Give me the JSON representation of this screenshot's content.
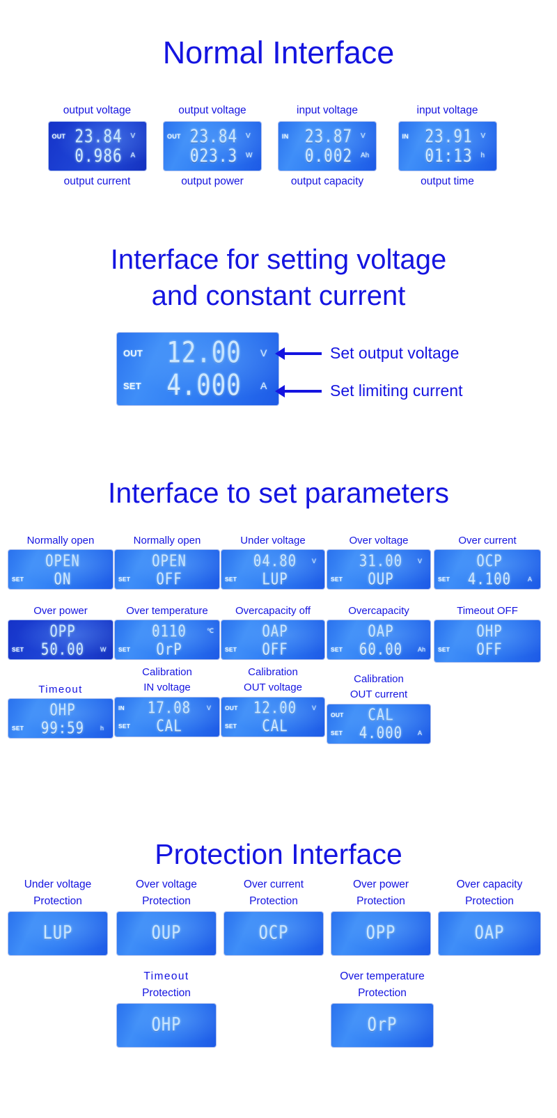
{
  "sections": {
    "normal_title": "Normal Interface",
    "setting_title_line1": "Interface for setting voltage",
    "setting_title_line2": "and constant current",
    "params_title": "Interface to set parameters",
    "protection_title": "Protection Interface"
  },
  "colors": {
    "text_blue": "#1414e0",
    "lcd_blue": "#2f7df4",
    "lcd_blue_dark": "#1633c8",
    "segment": "#d6ecff"
  },
  "normal": [
    {
      "caption_top": "output voltage",
      "caption_bottom": "output current",
      "lcd_style": "dark",
      "line1": {
        "tag": "OUT",
        "value": "23.84",
        "unit": "V"
      },
      "line2": {
        "tag": "",
        "value": "0.986",
        "unit": "A"
      }
    },
    {
      "caption_top": "output voltage",
      "caption_bottom": "output power",
      "lcd_style": "bright",
      "line1": {
        "tag": "OUT",
        "value": "23.84",
        "unit": "V"
      },
      "line2": {
        "tag": "",
        "value": "023.3",
        "unit": "W"
      }
    },
    {
      "caption_top": "input voltage",
      "caption_bottom": "output capacity",
      "lcd_style": "bright",
      "line1": {
        "tag": "IN",
        "value": "23.87",
        "unit": "V"
      },
      "line2": {
        "tag": "",
        "value": "0.002",
        "unit": "Ah"
      }
    },
    {
      "caption_top": "input voltage",
      "caption_bottom": "output time",
      "lcd_style": "bright",
      "line1": {
        "tag": "IN",
        "value": "23.91",
        "unit": "V"
      },
      "line2": {
        "tag": "",
        "value": "01:13",
        "unit": "h"
      }
    }
  ],
  "setting": {
    "lcd": {
      "line1": {
        "tag": "OUT",
        "value": "12.00",
        "unit": "V"
      },
      "line2": {
        "tag": "SET",
        "value": "4.000",
        "unit": "A"
      }
    },
    "annotation_voltage": "Set output voltage",
    "annotation_current": "Set limiting current"
  },
  "params": [
    [
      {
        "caption": "Normally open",
        "lcd_style": "bright",
        "line1": {
          "tag": "",
          "value": "OPEN",
          "unit": ""
        },
        "line2": {
          "tag": "SET",
          "value": "ON",
          "unit": ""
        }
      },
      {
        "caption": "Normally open",
        "lcd_style": "bright",
        "line1": {
          "tag": "",
          "value": "OPEN",
          "unit": ""
        },
        "line2": {
          "tag": "SET",
          "value": "OFF",
          "unit": ""
        }
      },
      {
        "caption": "Under voltage",
        "lcd_style": "bright",
        "line1": {
          "tag": "",
          "value": "04.80",
          "unit": "V"
        },
        "line2": {
          "tag": "SET",
          "value": "LUP",
          "unit": ""
        }
      },
      {
        "caption": "Over voltage",
        "lcd_style": "bright",
        "line1": {
          "tag": "",
          "value": "31.00",
          "unit": "V"
        },
        "line2": {
          "tag": "SET",
          "value": "OUP",
          "unit": ""
        }
      },
      {
        "caption": "Over current",
        "lcd_style": "bright",
        "line1": {
          "tag": "",
          "value": "OCP",
          "unit": ""
        },
        "line2": {
          "tag": "SET",
          "value": "4.100",
          "unit": "A"
        }
      }
    ],
    [
      {
        "caption": "Over power",
        "lcd_style": "dark",
        "line1": {
          "tag": "",
          "value": "OPP",
          "unit": ""
        },
        "line2": {
          "tag": "SET",
          "value": "50.00",
          "unit": "W"
        }
      },
      {
        "caption": "Over temperature",
        "lcd_style": "bright",
        "line1": {
          "tag": "",
          "value": "0110",
          "unit": "℃"
        },
        "line2": {
          "tag": "SET",
          "value": "OrP",
          "unit": ""
        }
      },
      {
        "caption": "Overcapacity off",
        "lcd_style": "bright",
        "line1": {
          "tag": "",
          "value": "OAP",
          "unit": ""
        },
        "line2": {
          "tag": "SET",
          "value": "OFF",
          "unit": ""
        }
      },
      {
        "caption": "Overcapacity",
        "lcd_style": "bright",
        "line1": {
          "tag": "",
          "value": "OAP",
          "unit": ""
        },
        "line2": {
          "tag": "SET",
          "value": "60.00",
          "unit": "Ah"
        }
      },
      {
        "caption": "Timeout OFF",
        "lcd_style": "bright",
        "line1": {
          "tag": "",
          "value": "OHP",
          "unit": ""
        },
        "line2": {
          "tag": "SET",
          "value": "OFF",
          "unit": ""
        }
      }
    ],
    [
      {
        "caption": "Timeout",
        "caption2": "",
        "lcd_style": "bright",
        "line1": {
          "tag": "",
          "value": "OHP",
          "unit": ""
        },
        "line2": {
          "tag": "SET",
          "value": "99:59",
          "unit": "h"
        }
      },
      {
        "caption": "Calibration",
        "caption2": "IN voltage",
        "lcd_style": "bright",
        "line1": {
          "tag": "IN",
          "value": "17.08",
          "unit": "V"
        },
        "line2": {
          "tag": "SET",
          "value": "CAL",
          "unit": ""
        }
      },
      {
        "caption": "Calibration",
        "caption2": "OUT voltage",
        "lcd_style": "bright",
        "line1": {
          "tag": "OUT",
          "value": "12.00",
          "unit": "V"
        },
        "line2": {
          "tag": "SET",
          "value": "CAL",
          "unit": ""
        }
      },
      {
        "caption": "Calibration",
        "caption2": "OUT current",
        "lcd_style": "bright",
        "line1": {
          "tag": "OUT",
          "value": "CAL",
          "unit": ""
        },
        "line2": {
          "tag": "SET",
          "value": "4.000",
          "unit": "A"
        }
      }
    ]
  ],
  "protection": [
    [
      {
        "caption1": "Under voltage",
        "caption2": "Protection",
        "value": "LUP"
      },
      {
        "caption1": "Over voltage",
        "caption2": "Protection",
        "value": "OUP"
      },
      {
        "caption1": "Over current",
        "caption2": "Protection",
        "value": "OCP"
      },
      {
        "caption1": "Over power",
        "caption2": "Protection",
        "value": "OPP"
      },
      {
        "caption1": "Over capacity",
        "caption2": "Protection",
        "value": "OAP"
      }
    ],
    [
      {
        "caption1": "Timeout",
        "caption2": "Protection",
        "value": "OHP"
      },
      {
        "caption1": "Over temperature",
        "caption2": "Protection",
        "value": "OrP"
      }
    ]
  ]
}
